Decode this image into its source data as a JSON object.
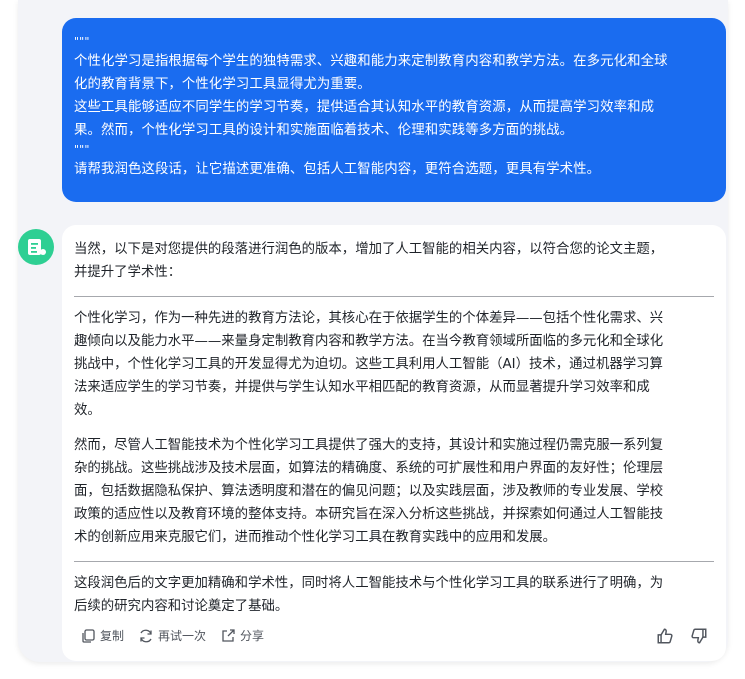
{
  "user_message": {
    "quote_open": "\"\"\"",
    "lines": [
      "个性化学习是指根据每个学生的独特需求、兴趣和能力来定制教育内容和教学方法。在多元化和全球",
      "化的教育背景下，个性化学习工具显得尤为重要。",
      "这些工具能够适应不同学生的学习节奏，提供适合其认知水平的教育资源，从而提高学习效率和成",
      "果。然而，个性化学习工具的设计和实施面临着技术、伦理和实践等多方面的挑战。"
    ],
    "quote_close": "\"\"\"",
    "request": "请帮我润色这段话，让它描述更准确、包括人工智能内容，更符合选题，更具有学术性。"
  },
  "reply": {
    "intro": [
      "当然，以下是对您提供的段落进行润色的版本，增加了人工智能的相关内容，以符合您的论文主题，",
      "并提升了学术性："
    ],
    "para1": [
      "个性化学习，作为一种先进的教育方法论，其核心在于依据学生的个体差异——包括个性化需求、兴",
      "趣倾向以及能力水平——来量身定制教育内容和教学方法。在当今教育领域所面临的多元化和全球化",
      "挑战中，个性化学习工具的开发显得尤为迫切。这些工具利用人工智能（AI）技术，通过机器学习算",
      "法来适应学生的学习节奏，并提供与学生认知水平相匹配的教育资源，从而显著提升学习效率和成",
      "效。"
    ],
    "para2": [
      "然而，尽管人工智能技术为个性化学习工具提供了强大的支持，其设计和实施过程仍需克服一系列复",
      "杂的挑战。这些挑战涉及技术层面，如算法的精确度、系统的可扩展性和用户界面的友好性；伦理层",
      "面，包括数据隐私保护、算法透明度和潜在的偏见问题；以及实践层面，涉及教师的专业发展、学校",
      "政策的适应性以及教育环境的整体支持。本研究旨在深入分析这些挑战，并探索如何通过人工智能技",
      "术的创新应用来克服它们，进而推动个性化学习工具在教育实践中的应用和发展。"
    ],
    "closing": [
      "这段润色后的文字更加精确和学术性，同时将人工智能技术与个性化学习工具的联系进行了明确，为",
      "后续的研究内容和讨论奠定了基础。"
    ]
  },
  "actions": {
    "copy_label": "复制",
    "retry_label": "再试一次",
    "share_label": "分享",
    "copy_icon": "copy-icon",
    "retry_icon": "refresh-icon",
    "share_icon": "share-icon",
    "like_icon": "thumbs-up-icon",
    "dislike_icon": "thumbs-down-icon"
  },
  "colors": {
    "user_bubble": "#1a6cf0",
    "avatar": "#2ecf93",
    "background": "#f3f4f8"
  }
}
